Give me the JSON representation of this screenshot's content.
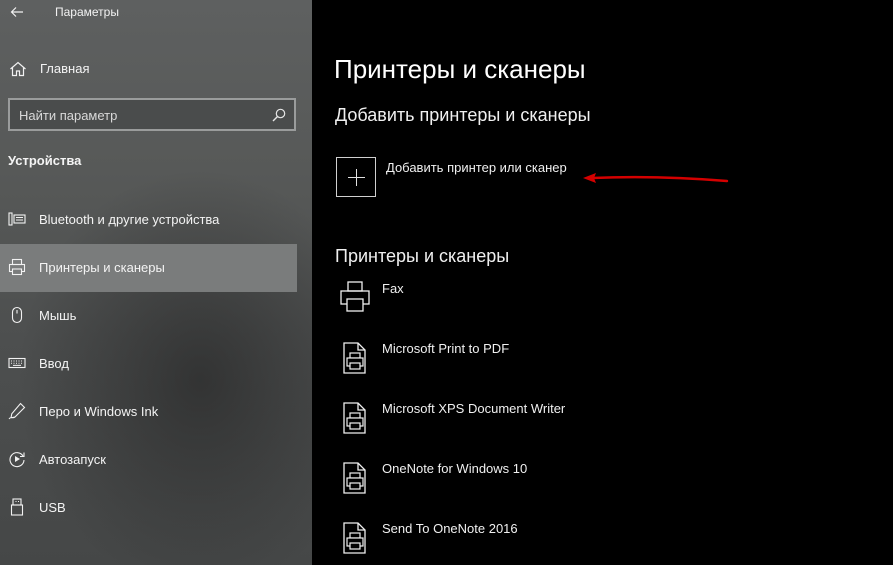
{
  "window": {
    "title": "Параметры"
  },
  "sidebar": {
    "home_label": "Главная",
    "search_placeholder": "Найти параметр",
    "section_title": "Устройства",
    "items": [
      {
        "label": "Bluetooth и другие устройства",
        "icon": "bluetooth-devices-icon",
        "active": false
      },
      {
        "label": "Принтеры и сканеры",
        "icon": "printer-icon",
        "active": true
      },
      {
        "label": "Мышь",
        "icon": "mouse-icon",
        "active": false
      },
      {
        "label": "Ввод",
        "icon": "keyboard-icon",
        "active": false
      },
      {
        "label": "Перо и Windows Ink",
        "icon": "pen-icon",
        "active": false
      },
      {
        "label": "Автозапуск",
        "icon": "autoplay-icon",
        "active": false
      },
      {
        "label": "USB",
        "icon": "usb-icon",
        "active": false
      }
    ]
  },
  "main": {
    "title": "Принтеры и сканеры",
    "add_section_title": "Добавить принтеры и сканеры",
    "add_button_label": "Добавить принтер или сканер",
    "list_title": "Принтеры и сканеры",
    "printers": [
      {
        "name": "Fax",
        "icon": "fax-icon"
      },
      {
        "name": "Microsoft Print to PDF",
        "icon": "printer-document-icon"
      },
      {
        "name": "Microsoft XPS Document Writer",
        "icon": "printer-document-icon"
      },
      {
        "name": "OneNote for Windows 10",
        "icon": "printer-document-icon"
      },
      {
        "name": "Send To OneNote 2016",
        "icon": "printer-document-icon"
      }
    ]
  },
  "colors": {
    "sidebar_bg": "#575958",
    "active_item_bg": "#7a7c7c",
    "main_bg": "#000000",
    "annotation_arrow": "#d40000"
  }
}
